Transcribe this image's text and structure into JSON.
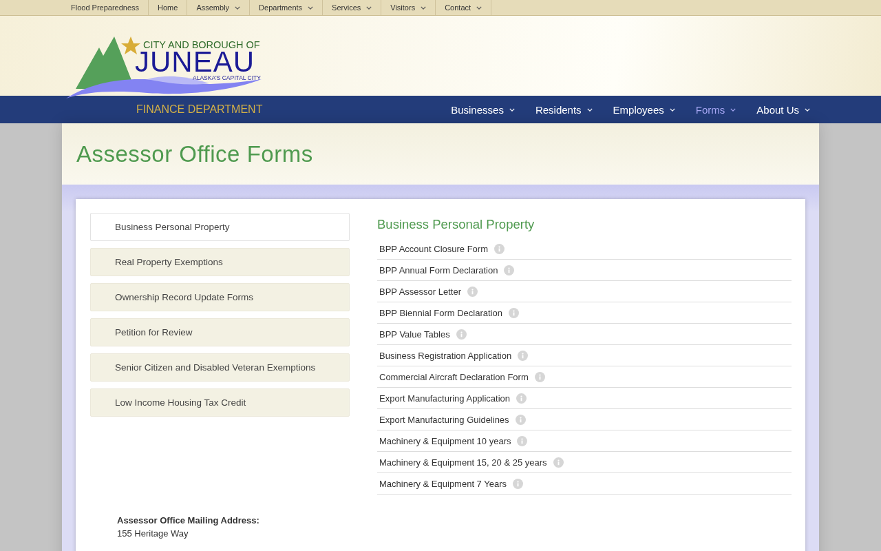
{
  "top_menu": [
    {
      "label": "Flood Preparedness",
      "dropdown": false
    },
    {
      "label": "Home",
      "dropdown": false
    },
    {
      "label": "Assembly",
      "dropdown": true
    },
    {
      "label": "Departments",
      "dropdown": true
    },
    {
      "label": "Services",
      "dropdown": true
    },
    {
      "label": "Visitors",
      "dropdown": true
    },
    {
      "label": "Contact",
      "dropdown": true
    }
  ],
  "logo": {
    "line_1": "CITY AND BOROUGH OF",
    "line_2": "JUNEAU",
    "line_3": "ALASKA'S CAPITAL CITY",
    "department": "FINANCE DEPARTMENT"
  },
  "main_nav": [
    {
      "label": "Businesses",
      "selected": false
    },
    {
      "label": "Residents",
      "selected": false
    },
    {
      "label": "Employees",
      "selected": false
    },
    {
      "label": "Forms",
      "selected": true
    },
    {
      "label": "About Us",
      "selected": false
    }
  ],
  "page_title": "Assessor Office Forms",
  "sidebar": {
    "items": [
      {
        "label": "Business Personal Property",
        "selected": true
      },
      {
        "label": "Real Property Exemptions",
        "selected": false
      },
      {
        "label": "Ownership Record Update Forms",
        "selected": false
      },
      {
        "label": "Petition for Review",
        "selected": false
      },
      {
        "label": "Senior Citizen and Disabled Veteran Exemptions",
        "selected": false
      },
      {
        "label": "Low Income Housing Tax Credit",
        "selected": false
      }
    ]
  },
  "section": {
    "heading": "Business Personal Property",
    "forms": [
      "BPP Account Closure Form",
      "BPP Annual Form Declaration",
      "BPP Assessor Letter",
      "BPP Biennial Form Declaration",
      "BPP Value Tables",
      "Business Registration Application",
      "Commercial Aircraft Declaration Form",
      "Export Manufacturing Application",
      "Export Manufacturing Guidelines",
      "Machinery & Equipment 10 years",
      "Machinery & Equipment 15, 20 & 25 years",
      "Machinery & Equipment 7 Years"
    ]
  },
  "address": {
    "heading": "Assessor Office Mailing Address:",
    "line_1": "155 Heritage Way"
  }
}
